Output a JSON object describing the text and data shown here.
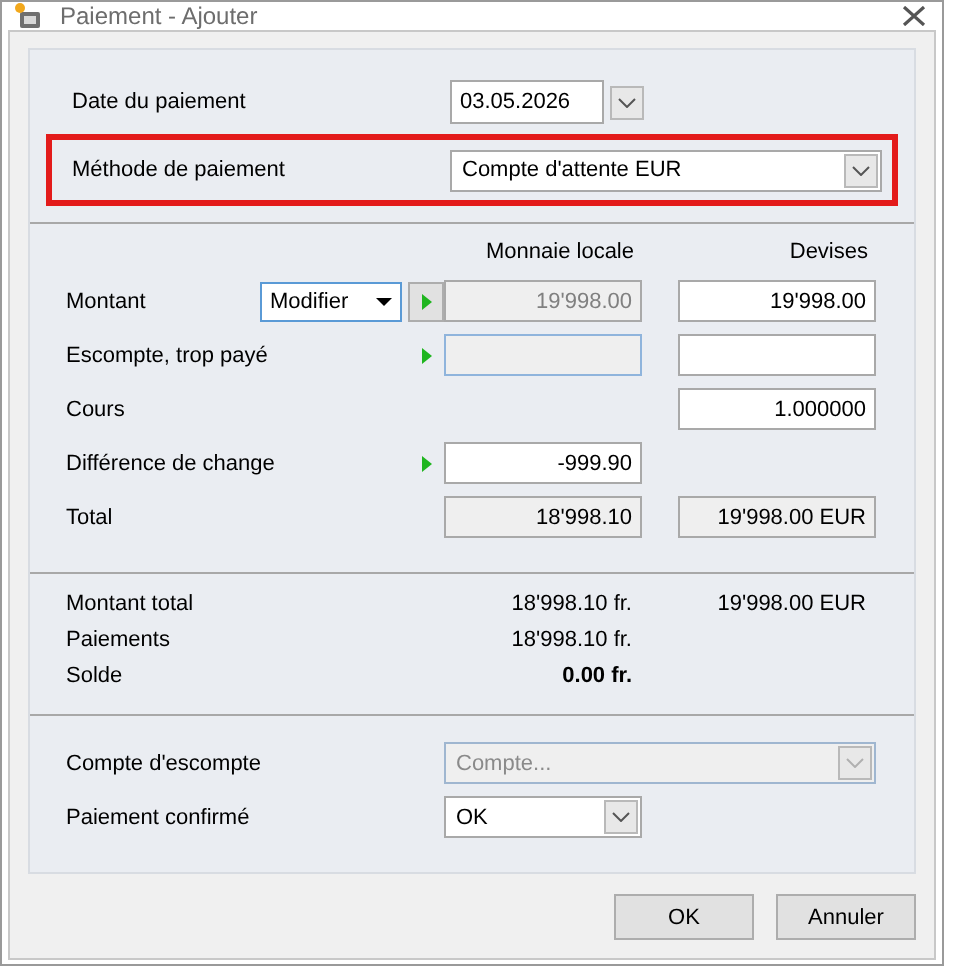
{
  "window": {
    "title": "Paiement - Ajouter"
  },
  "header": [
    {
      "label": "Date du paiement",
      "value": "03.05.2026",
      "kind": "date",
      "highlighted": false
    },
    {
      "label": "Méthode de paiement",
      "value": "Compte d'attente EUR",
      "kind": "select",
      "highlighted": true
    }
  ],
  "amounts": {
    "columns": [
      "Monnaie locale",
      "Devises"
    ],
    "rows": [
      {
        "label": "Montant",
        "mode": "Modifier",
        "arrow": true,
        "local": {
          "value": "19'998.00",
          "readonly": true,
          "focused": false
        },
        "foreign": {
          "value": "19'998.00",
          "readonly": false
        }
      },
      {
        "label": "Escompte, trop payé",
        "arrow": true,
        "local": {
          "readonly": true,
          "focused": true
        },
        "foreign": {
          "readonly": false
        }
      },
      {
        "label": "Cours",
        "arrow": false,
        "foreign": {
          "value": "1.000000",
          "readonly": false
        }
      },
      {
        "label": "Différence de change",
        "arrow": true,
        "local": {
          "value": "-999.90",
          "readonly": false,
          "focused": false
        }
      },
      {
        "label": "Total",
        "arrow": false,
        "local": {
          "value": "18'998.10",
          "readonly": true,
          "focused": false
        },
        "foreign": {
          "value": "19'998.00 EUR",
          "readonly": true
        }
      }
    ]
  },
  "summary": [
    {
      "label": "Montant total",
      "local": "18'998.10 fr.",
      "foreign": "19'998.00 EUR",
      "bold": false
    },
    {
      "label": "Paiements",
      "local": "18'998.10 fr.",
      "bold": false
    },
    {
      "label": "Solde",
      "local": "0.00 fr.",
      "bold": true
    }
  ],
  "options": [
    {
      "label": "Compte d'escompte",
      "placeholder": "Compte...",
      "disabled": true,
      "wide": true
    },
    {
      "label": "Paiement confirmé",
      "value": "OK",
      "disabled": false,
      "wide": false
    }
  ],
  "buttons": [
    {
      "label": "OK"
    },
    {
      "label": "Annuler"
    }
  ]
}
